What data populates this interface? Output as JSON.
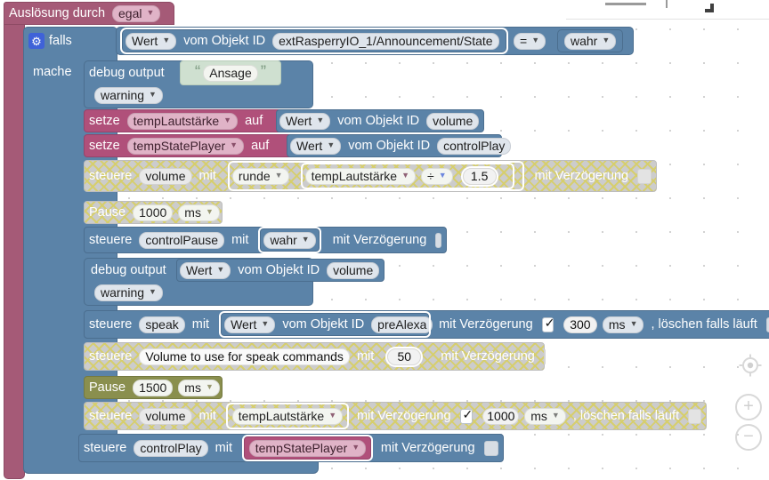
{
  "app": {
    "type": "blockly-workspace",
    "language": "de"
  },
  "colors": {
    "hat": "#a55a77",
    "control": "#5b83a8",
    "variable": "#b0507a",
    "text": "#cfe0d0",
    "time": "#8a8f4e",
    "disabled_hatch": "#d6ce6a",
    "disabled_body": "#cccccc",
    "canvas": "#ffffff"
  },
  "trigger": {
    "label": "Auslösung durch",
    "mode": "egal",
    "dropdown_icon": "chevron-down-icon"
  },
  "if_block": {
    "gear_icon": "gear-icon",
    "label": "falls",
    "do_label": "mache",
    "condition": {
      "left": {
        "selector": "Wert",
        "prefix": "vom Objekt ID",
        "object_id": "extRasperryIO_1/Announcement/State"
      },
      "operator": "=",
      "right": "wahr"
    }
  },
  "statements": [
    {
      "id": "debug-1",
      "kind": "debug",
      "disabled": false,
      "label": "debug output",
      "level": "warning",
      "text_value": "Ansage",
      "quote_open": "“",
      "quote_close": "”"
    },
    {
      "id": "set-1",
      "kind": "set-variable",
      "disabled": false,
      "label": "setze",
      "variable": "tempLautstärke",
      "to_label": "auf",
      "value": {
        "selector": "Wert",
        "prefix": "vom Objekt ID",
        "object_id": "volume"
      }
    },
    {
      "id": "set-2",
      "kind": "set-variable",
      "disabled": false,
      "label": "setze",
      "variable": "tempStatePlayer",
      "to_label": "auf",
      "value": {
        "selector": "Wert",
        "prefix": "vom Objekt ID",
        "object_id": "controlPlay"
      }
    },
    {
      "id": "control-1",
      "kind": "control",
      "disabled": true,
      "label": "steuere",
      "target": "volume",
      "with_label": "mit",
      "math": {
        "fn": "runde",
        "operand_a": "tempLautstärke",
        "operator": "÷",
        "operand_b": "1.5"
      },
      "delay_label": "mit Verzögerung",
      "delay_checked": false
    },
    {
      "id": "pause-1",
      "kind": "pause",
      "disabled": true,
      "label": "Pause",
      "value": "1000",
      "unit": "ms"
    },
    {
      "id": "control-2",
      "kind": "control",
      "disabled": false,
      "label": "steuere",
      "target": "controlPause",
      "with_label": "mit",
      "value": "wahr",
      "delay_label": "mit Verzögerung",
      "delay_checked": false
    },
    {
      "id": "debug-2",
      "kind": "debug",
      "disabled": false,
      "label": "debug output",
      "level": "warning",
      "value": {
        "selector": "Wert",
        "prefix": "vom Objekt ID",
        "object_id": "volume"
      }
    },
    {
      "id": "control-3",
      "kind": "control",
      "disabled": false,
      "label": "steuere",
      "target": "speak",
      "with_label": "mit",
      "value": {
        "selector": "Wert",
        "prefix": "vom Objekt ID",
        "object_id": "preAlexa"
      },
      "delay_label": "mit Verzögerung",
      "delay_checked": true,
      "delay_value": "300",
      "delay_unit": "ms",
      "clear_label": ", löschen falls läuft",
      "clear_checked": false
    },
    {
      "id": "control-4",
      "kind": "control",
      "disabled": true,
      "label": "steuere",
      "target": "Volume to use for speak commands",
      "with_label": "mit",
      "value": "50",
      "delay_label": "mit Verzögerung",
      "delay_checked": false
    },
    {
      "id": "pause-2",
      "kind": "pause",
      "disabled": false,
      "label": "Pause",
      "value": "1500",
      "unit": "ms"
    },
    {
      "id": "control-5",
      "kind": "control",
      "disabled": true,
      "label": "steuere",
      "target": "volume",
      "with_label": "mit",
      "variable_value": "tempLautstärke",
      "delay_label": "mit Verzögerung",
      "delay_checked": true,
      "delay_value": "1000",
      "delay_unit": "ms",
      "clear_label": ", löschen falls läuft",
      "clear_checked": false
    },
    {
      "id": "control-6",
      "kind": "control",
      "disabled": false,
      "label": "steuere",
      "target": "controlPlay",
      "with_label": "mit",
      "variable_value": "tempStatePlayer",
      "delay_label": "mit Verzögerung",
      "delay_checked": false
    }
  ],
  "zoom_controls": {
    "center_icon": "crosshair-target-icon",
    "zoom_in_label": "+",
    "zoom_out_label": "−"
  }
}
